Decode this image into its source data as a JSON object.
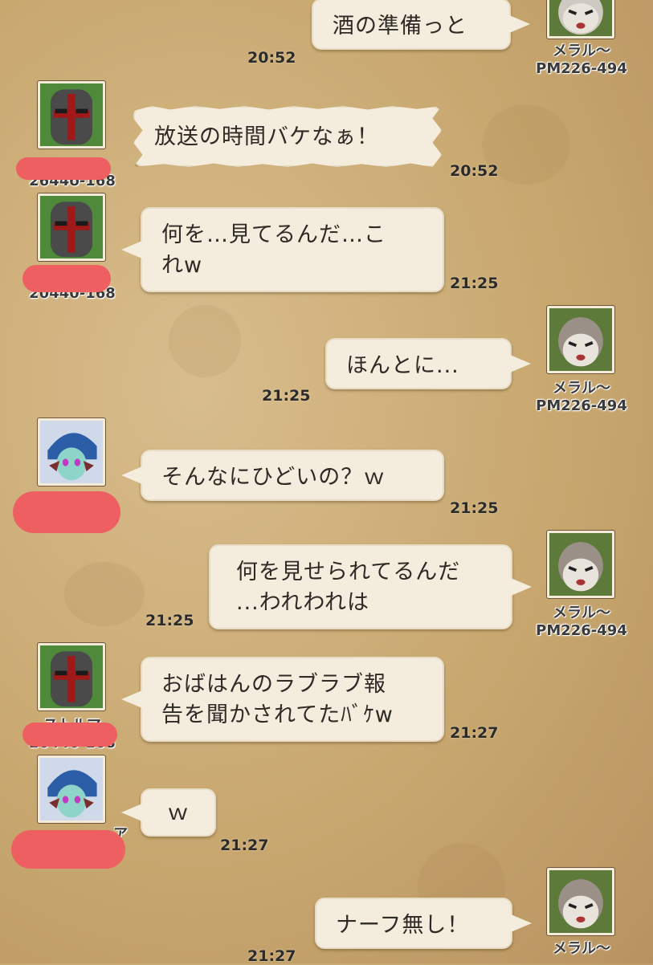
{
  "messages": [
    {
      "text": "酒の準備っと",
      "time": "20:52",
      "sender": "メラル〜",
      "id": "PM226-494"
    },
    {
      "text": "放送の時間バケなぁ！",
      "time": "20:52",
      "id": "2644б-168"
    },
    {
      "text": "何を…見てるんだ…これw",
      "time": "21:25",
      "id": "20440-168"
    },
    {
      "text": "ほんとに...",
      "time": "21:25",
      "sender": "メラル〜",
      "id": "PM226-494"
    },
    {
      "text": "そんなにひどいの？ｗ",
      "time": "21:25"
    },
    {
      "text": "何を見せられてるんだ\n...われわれは",
      "time": "21:25",
      "sender": "メラル〜",
      "id": "PM226-494"
    },
    {
      "text": "おばはんのラブラブ報告を聞かされてたﾊﾞｹw",
      "time": "21:27",
      "sender": "ストルマ",
      "id": "20440-168"
    },
    {
      "text": "ｗ",
      "time": "21:27",
      "sender": "ア"
    },
    {
      "text": "ナーフ無し！",
      "time": "21:27",
      "sender": "メラル〜"
    }
  ],
  "line_breaks": {
    "m2": [
      "何を…見てるんだ…こ",
      "れw"
    ],
    "m5": [
      "何を見せられてるんだ",
      "...われわれは"
    ],
    "m6": [
      "おばはんのラブラブ報",
      "告を聞かされてたﾊﾞｹw"
    ]
  },
  "colors": {
    "background": "#c9a870",
    "bubble": "#f4ecdc",
    "redaction": "#ee5f61"
  },
  "icons": {
    "knight": "knight-helmet-avatar-icon",
    "cat": "cat-hood-avatar-icon",
    "elf": "blue-hair-elf-avatar-icon"
  }
}
